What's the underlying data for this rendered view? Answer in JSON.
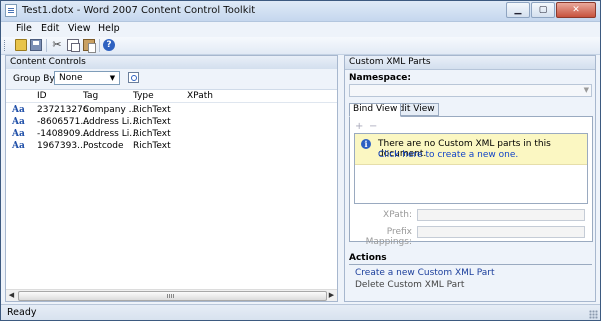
{
  "window": {
    "title": "Test1.dotx - Word 2007 Content Control Toolkit"
  },
  "menu": [
    "File",
    "Edit",
    "View",
    "Help"
  ],
  "toolbar": {
    "icons": [
      "open-folder-icon",
      "save-icon",
      "cut-icon",
      "copy-icon",
      "paste-icon",
      "help-icon"
    ]
  },
  "content_controls": {
    "header": "Content Controls",
    "group_by_label": "Group By:",
    "group_by_value": "None",
    "columns": [
      "ID",
      "Tag",
      "Type",
      "XPath"
    ],
    "rows": [
      {
        "icon": "Aa",
        "id": "237213276",
        "tag": "Company ...",
        "type": "RichText",
        "xpath": ""
      },
      {
        "icon": "Aa",
        "id": "-8606571...",
        "tag": "Address Li...",
        "type": "RichText",
        "xpath": ""
      },
      {
        "icon": "Aa",
        "id": "-1408909...",
        "tag": "Address Li...",
        "type": "RichText",
        "xpath": ""
      },
      {
        "icon": "Aa",
        "id": "1967393...",
        "tag": "Postcode",
        "type": "RichText",
        "xpath": ""
      }
    ]
  },
  "xml_parts": {
    "header": "Custom XML Parts",
    "namespace_label": "Namespace:",
    "namespace_value": "",
    "tabs": [
      "Bind View",
      "Edit View"
    ],
    "active_tab": "Bind View",
    "add_symbol": "+",
    "remove_symbol": "−",
    "info_message": "There are no Custom XML parts in this document.",
    "info_link": "Click here to create a new one.",
    "xpath_label": "XPath:",
    "prefix_label": "Prefix Mappings:",
    "actions_header": "Actions",
    "action_create": "Create a new Custom XML Part",
    "action_delete": "Delete Custom XML Part"
  },
  "status": {
    "text": "Ready"
  }
}
